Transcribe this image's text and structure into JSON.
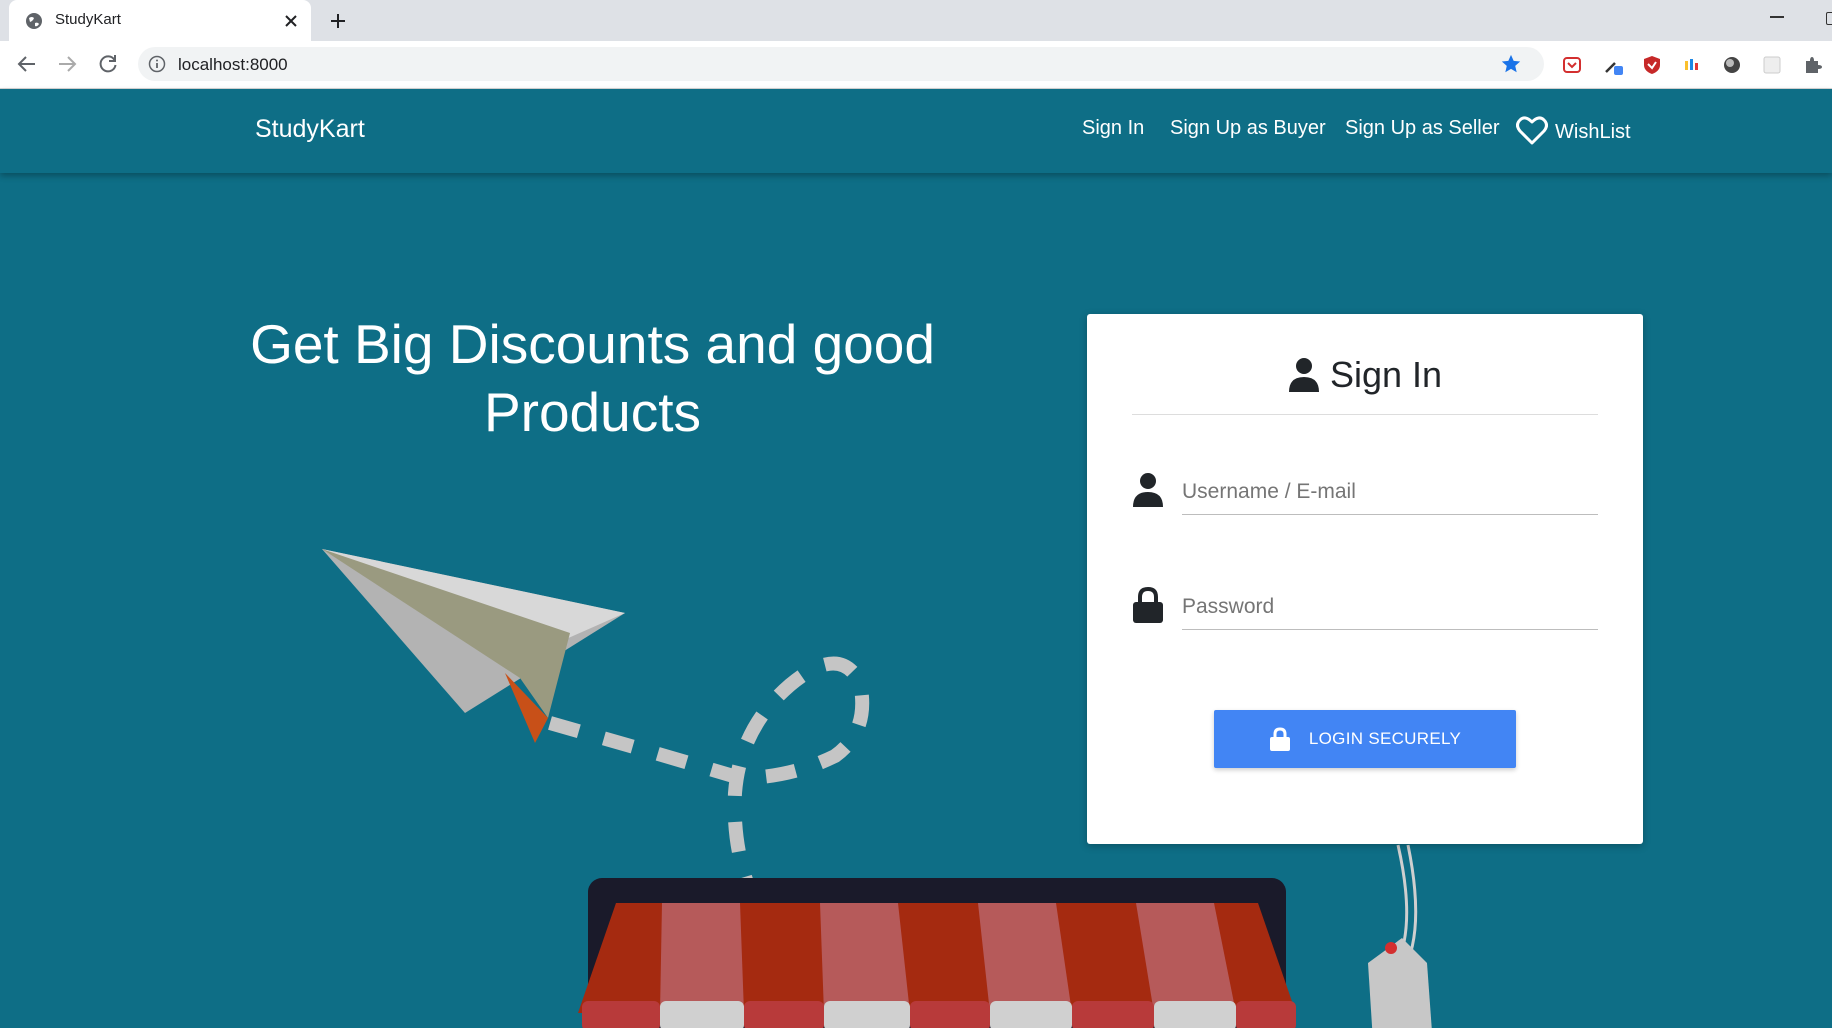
{
  "browser": {
    "tab_title": "StudyKart",
    "url": "localhost:8000"
  },
  "nav": {
    "brand": "StudyKart",
    "links": [
      "Sign In",
      "Sign Up as Buyer",
      "Sign Up as Seller"
    ],
    "wishlist": "WishList"
  },
  "hero": {
    "title": "Get Big Discounts and good Products"
  },
  "signin": {
    "title": "Sign In",
    "username_placeholder": "Username / E-mail",
    "password_placeholder": "Password",
    "button_label": "LOGIN SECURELY"
  },
  "colors": {
    "page_bg": "#0e6e86",
    "button": "#4285f4",
    "star": "#1a73e8"
  },
  "icons": [
    "globe-icon",
    "close-icon",
    "plus-icon",
    "back-icon",
    "forward-icon",
    "reload-icon",
    "info-icon",
    "star-icon",
    "user-icon",
    "lock-icon",
    "heart-icon"
  ]
}
